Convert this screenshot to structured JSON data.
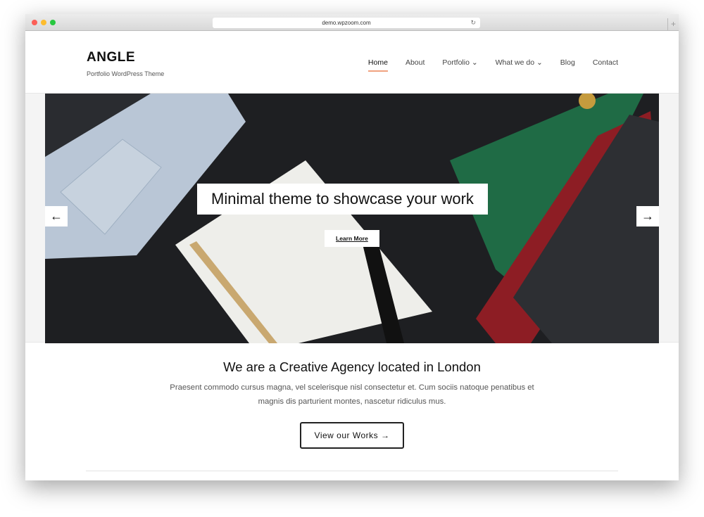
{
  "browser": {
    "url": "demo.wpzoom.com",
    "new_tab": "+"
  },
  "site": {
    "title": "ANGLE",
    "tagline": "Portfolio WordPress Theme"
  },
  "nav": [
    {
      "label": "Home",
      "active": true
    },
    {
      "label": "About"
    },
    {
      "label": "Portfolio ⌄"
    },
    {
      "label": "What we do ⌄"
    },
    {
      "label": "Blog"
    },
    {
      "label": "Contact"
    }
  ],
  "hero": {
    "title": "Minimal theme to showcase your work",
    "button": "Learn More",
    "prev": "←",
    "next": "→"
  },
  "intro": {
    "heading": "We are a Creative Agency located in London",
    "text": "Praesent commodo cursus magna, vel scelerisque nisl consectetur et. Cum sociis natoque penatibus et magnis dis parturient montes, nascetur ridiculus mus.",
    "button": "View our Works →"
  },
  "colors": {
    "accent": "#f0a27f"
  }
}
